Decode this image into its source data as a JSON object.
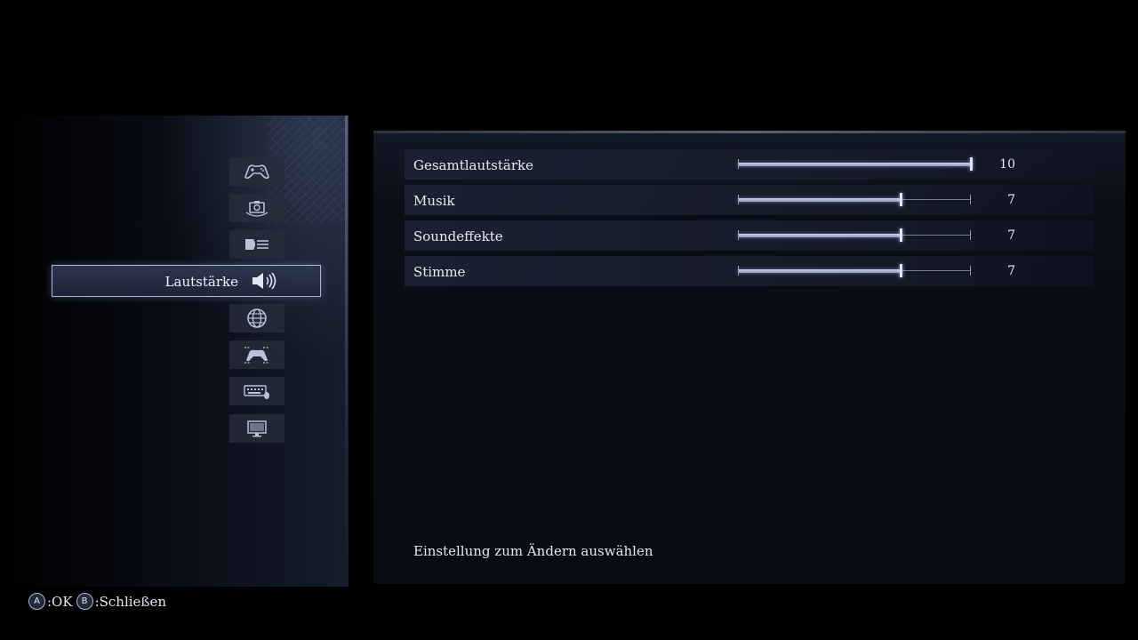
{
  "categories": [
    {
      "icon": "controller-icon",
      "label": ""
    },
    {
      "icon": "camera-icon",
      "label": ""
    },
    {
      "icon": "display-text-icon",
      "label": ""
    },
    {
      "icon": "speaker-icon",
      "label": "Lautstärke",
      "selected": true
    },
    {
      "icon": "globe-icon",
      "label": ""
    },
    {
      "icon": "controller-mapping-icon",
      "label": ""
    },
    {
      "icon": "keyboard-mouse-icon",
      "label": ""
    },
    {
      "icon": "monitor-icon",
      "label": ""
    }
  ],
  "selected_category": "Lautstärke",
  "settings": [
    {
      "name": "Gesamtlautstärke",
      "value": "10",
      "level": 10,
      "max": 10
    },
    {
      "name": "Musik",
      "value": "7",
      "level": 7,
      "max": 10
    },
    {
      "name": "Soundeffekte",
      "value": "7",
      "level": 7,
      "max": 10
    },
    {
      "name": "Stimme",
      "value": "7",
      "level": 7,
      "max": 10
    }
  ],
  "hint": "Einstellung zum Ändern auswählen",
  "footer": {
    "a_button": "A",
    "a_label": ":OK",
    "b_button": "B",
    "b_label": ":Schließen"
  }
}
